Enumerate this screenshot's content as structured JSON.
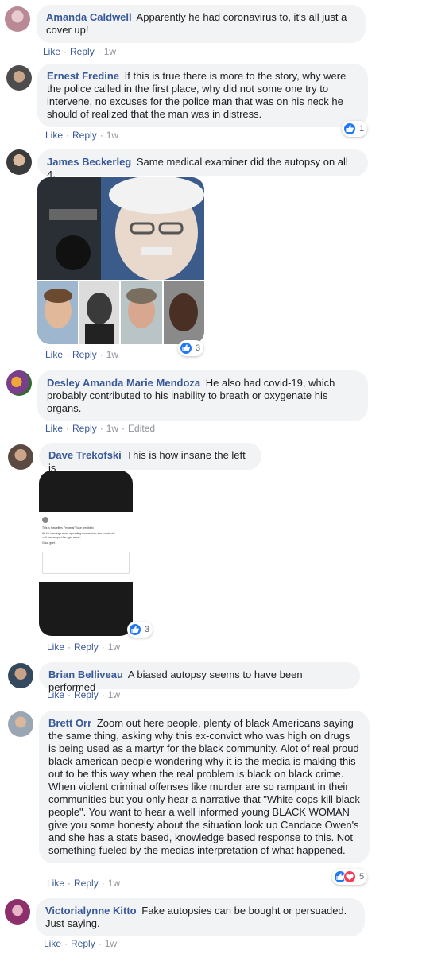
{
  "actions": {
    "like": "Like",
    "reply": "Reply"
  },
  "comments": [
    {
      "name": "Amanda Caldwell",
      "text": "Apparently he had coronavirus to, it's all just a cover up!",
      "time": "1w"
    },
    {
      "name": "Ernest Fredine",
      "text": "If this is true there is more to the story, why were the police called in the first place, why did not some one try to intervene, no excuses for the police man that was on his neck he should of realized that the man was in distress.",
      "time": "1w",
      "reactions": "1"
    },
    {
      "name": "James Beckerleg",
      "text": "Same medical examiner did the autopsy on all 4.",
      "time": "1w",
      "reactions": "3"
    },
    {
      "name": "Desley Amanda Marie Mendoza",
      "text": "He also had covid-19, which probably contributed to his inability to breath or oxygenate his organs.",
      "time": "1w",
      "edited": "Edited"
    },
    {
      "name": "Dave Trekofski",
      "text": "This is how insane the left is",
      "time": "1w",
      "reactions": "3"
    },
    {
      "name": "Brian Belliveau",
      "text": "A biased autopsy seems to have been performed",
      "time": "1w"
    },
    {
      "name": "Brett Orr",
      "text": "Zoom out here people, plenty of black Americans saying the same thing, asking why this ex-convict who was high on drugs is being used as a martyr for the black community. Alot of real proud black american people wondering why it is the media is making this out to be this way when the real problem is black on black crime. When violent criminal offenses like murder are so rampant in their communities but you only hear a narrative that \"White cops kill black people\". You want to hear a well informed young BLACK WOMAN give you some honesty about the situation look up Candace Owen's and she has a stats based, knowledge based response to this. Not something fueled by the medias interpretation of what happened.",
      "time": "1w",
      "reactions": "5"
    },
    {
      "name": "Victorialynne Kitto",
      "text": "Fake autopsies can be bought or persuaded. Just saying.",
      "time": "1w"
    }
  ],
  "tweet": {
    "line1": "This is how elites (\"experts\") lose credibility",
    "line2": "All the warnings about spreading coronavirus now immaterial",
    "line3": "— if you support the right cause.",
    "line4": "Good grief."
  }
}
